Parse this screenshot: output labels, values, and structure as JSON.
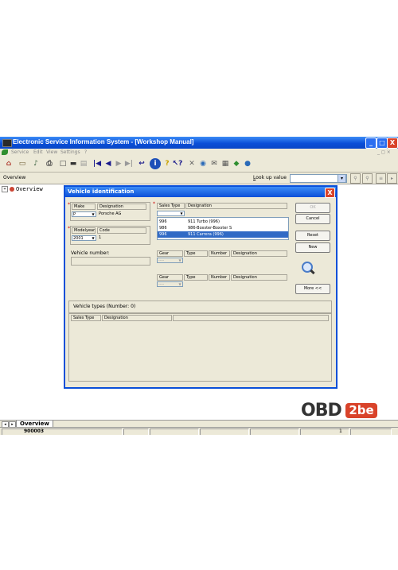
{
  "window": {
    "title": "Electronic Service Information System - [Workshop Manual]",
    "minimize": "_",
    "restore": "□",
    "close": "X"
  },
  "menu": {
    "items": [
      "Service",
      "Edit",
      "View",
      "Settings",
      "?"
    ],
    "right": "_ ◻ ×"
  },
  "toolbar": {
    "icons": [
      "home-icon",
      "open-icon",
      "sound-icon",
      "print-icon",
      "new-page-icon",
      "car-icon",
      "fax-icon",
      "first-icon",
      "prev-icon",
      "next-icon",
      "last-icon",
      "return-icon",
      "info-icon",
      "help-icon",
      "context-help-icon",
      "tools-icon",
      "database-icon",
      "mail-icon",
      "document-icon",
      "book-icon",
      "globe-icon"
    ]
  },
  "lookup": {
    "left_label": "Overview",
    "label_prefix": "L",
    "label_rest": "ook up value",
    "value": "",
    "dropdown": "▾"
  },
  "tree": {
    "expander": "+",
    "label": "Overview"
  },
  "tabs": {
    "nav_prev": "◂",
    "nav_next": "▸",
    "active": "Overview"
  },
  "status": {
    "code": "900003",
    "page": "1"
  },
  "logo": {
    "text": "OBD",
    "badge": "2be"
  },
  "dialog": {
    "title": "Vehicle identification",
    "close": "X",
    "make": {
      "header": "Make",
      "designation_header": "Designation",
      "value": "P",
      "designation": "Porsche AG"
    },
    "modelyear": {
      "header": "Modelyear",
      "code_header": "Code",
      "value": "2001",
      "code": "1"
    },
    "vehicle_number_label": "Vehicle number:",
    "sales_type": {
      "header": "Sales Type",
      "designation_header": "Designation",
      "value": "",
      "options": [
        {
          "code": "996",
          "designation": "911 Turbo (996)",
          "selected": false
        },
        {
          "code": "986",
          "designation": "986-Boxster-Boxster S",
          "selected": false
        },
        {
          "code": "996",
          "designation": "911 Carrera (996)",
          "selected": true
        }
      ]
    },
    "gear_group1": {
      "gear": "Gear",
      "type": "Type",
      "number": "Number",
      "designation": "Designation",
      "value": "----"
    },
    "gear_group2": {
      "gear": "Gear",
      "type": "Type",
      "number": "Number",
      "designation": "Designation",
      "value": "----"
    },
    "buttons": {
      "ok": "OK",
      "cancel": "Cancel",
      "reset": "Reset",
      "new": "New",
      "more": "More <<"
    },
    "vehicle_types_label": "Vehicle types (Number: 0)",
    "results_columns": [
      "Sales Type",
      "Designation"
    ]
  }
}
